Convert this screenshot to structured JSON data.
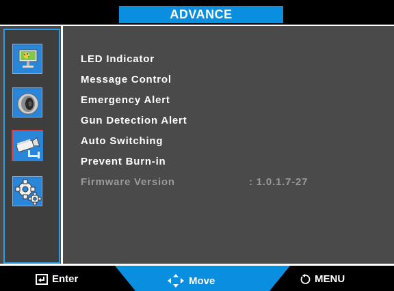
{
  "header": {
    "title": "ADVANCE"
  },
  "sidebar": {
    "items": [
      {
        "name": "picture",
        "icon": "picture-icon",
        "selected": false
      },
      {
        "name": "audio",
        "icon": "speaker-icon",
        "selected": false
      },
      {
        "name": "advance",
        "icon": "camera-icon",
        "selected": true
      },
      {
        "name": "system",
        "icon": "gear-icon",
        "selected": false
      }
    ]
  },
  "menu": {
    "items": [
      {
        "label": "LED Indicator",
        "enabled": true
      },
      {
        "label": "Message Control",
        "enabled": true
      },
      {
        "label": "Emergency Alert",
        "enabled": true
      },
      {
        "label": "Gun Detection Alert",
        "enabled": true
      },
      {
        "label": "Auto Switching",
        "enabled": true
      },
      {
        "label": "Prevent Burn-in",
        "enabled": true
      },
      {
        "label": "Firmware Version",
        "enabled": false,
        "value": ": 1.0.1.7-27"
      }
    ]
  },
  "footer": {
    "enter_label": "Enter",
    "move_label": "Move",
    "menu_label": "MENU"
  },
  "colors": {
    "accent": "#0a8fe0",
    "panel": "#4a4a4a",
    "selected_border": "#e23b3b",
    "disabled_text": "#9a9a9a"
  }
}
